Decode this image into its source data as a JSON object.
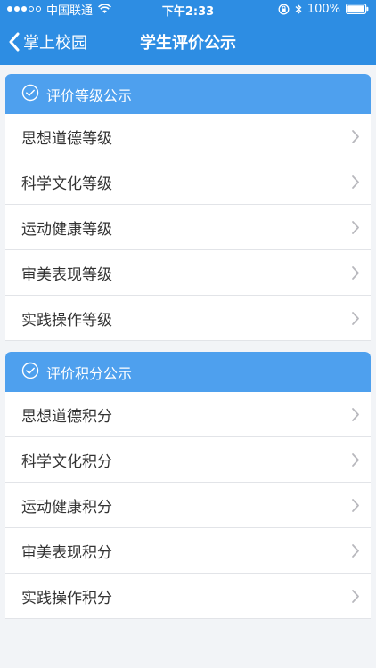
{
  "status": {
    "carrier": "中国联通",
    "time": "下午2:33",
    "battery": "100%"
  },
  "nav": {
    "back_label": "掌上校园",
    "title": "学生评价公示"
  },
  "sections": [
    {
      "header": "评价等级公示",
      "items": [
        "思想道德等级",
        "科学文化等级",
        "运动健康等级",
        "审美表现等级",
        "实践操作等级"
      ]
    },
    {
      "header": "评价积分公示",
      "items": [
        "思想道德积分",
        "科学文化积分",
        "运动健康积分",
        "审美表现积分",
        "实践操作积分"
      ]
    }
  ],
  "colors": {
    "navbar": "#2d8de3",
    "section_header": "#4ea0ee",
    "background": "#f2f4f7"
  }
}
